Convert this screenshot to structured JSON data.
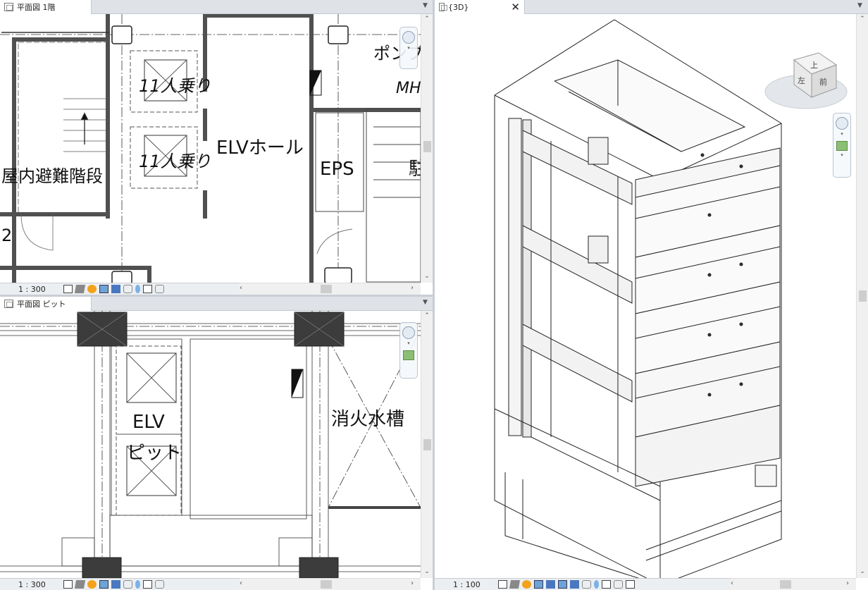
{
  "panes": {
    "top_left": {
      "tab_label": "平面図 1階",
      "scale": "1 : 300",
      "labels": {
        "elevator_1": "11人乗り",
        "elevator_2": "11人乗り",
        "elv_hall": "ELVホール",
        "eps": "EPS",
        "stairs": "屋内避難階段",
        "pump": "ポンプ",
        "mh": "MH",
        "partial_char": "駐",
        "grid_num": "2"
      }
    },
    "bottom_left": {
      "tab_label": "平面図 ピット",
      "scale": "1 : 300",
      "labels": {
        "elv": "ELV",
        "pit": "ピット",
        "fire_tank": "消火水槽"
      }
    },
    "right_3d": {
      "tab_label": "{3D}",
      "close_glyph": "✕",
      "scale": "1 : 100",
      "viewcube": {
        "top": "上",
        "left": "左",
        "front": "前"
      }
    }
  },
  "icons": {
    "tab_view": "floor-plan-icon",
    "tab_3d": "3d-view-icon",
    "menu": "chevron-down-icon",
    "scroll_up": "chevron-up-icon",
    "scroll_down": "chevron-down-icon",
    "scroll_left": "chevron-left-icon",
    "scroll_right": "chevron-right-icon"
  },
  "colors": {
    "wall": "#505050",
    "column": "#3c3c3c",
    "tab_bg": "#dfe3e8",
    "status_bg": "#eceff2"
  }
}
